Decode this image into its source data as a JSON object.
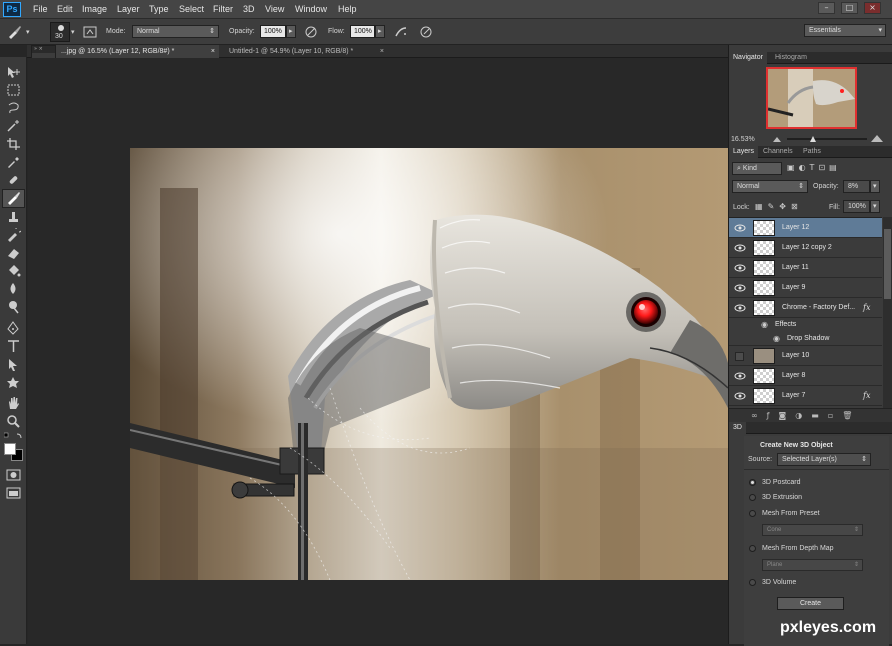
{
  "app": {
    "logo": "Ps"
  },
  "menu": [
    "File",
    "Edit",
    "Image",
    "Layer",
    "Type",
    "Select",
    "Filter",
    "3D",
    "View",
    "Window",
    "Help"
  ],
  "window_controls": [
    "–",
    "□",
    "×"
  ],
  "options_bar": {
    "brush_size": "30",
    "mode_label": "Mode:",
    "mode_value": "Normal",
    "opacity_label": "Opacity:",
    "opacity_value": "100%",
    "flow_label": "Flow:",
    "flow_value": "100%",
    "workspace": "Essentials"
  },
  "document_tabs": [
    {
      "label": "...jpg @ 16.5% (Layer 12, RGB/8#) *",
      "close": "×",
      "active": true
    },
    {
      "label": "Untitled-1 @ 54.9% (Layer 10, RGB/8) *",
      "close": "×",
      "active": false
    }
  ],
  "navigator": {
    "tabs": [
      "Navigator",
      "Histogram"
    ],
    "zoom": "16.53%"
  },
  "layers_panel": {
    "tabs": [
      "Layers",
      "Channels",
      "Paths"
    ],
    "kind_label": "Kind",
    "blend_mode": "Normal",
    "opacity_label": "Opacity:",
    "opacity_value": "8%",
    "lock_label": "Lock:",
    "fill_label": "Fill:",
    "fill_value": "100%",
    "layers": [
      {
        "name": "Layer 12",
        "visible": true,
        "selected": true,
        "fx": ""
      },
      {
        "name": "Layer 12 copy 2",
        "visible": true,
        "selected": false,
        "fx": ""
      },
      {
        "name": "Layer 11",
        "visible": true,
        "selected": false,
        "fx": ""
      },
      {
        "name": "Layer 9",
        "visible": true,
        "selected": false,
        "fx": ""
      },
      {
        "name": "Chrome - Factory Def...",
        "visible": true,
        "selected": false,
        "fx": "fx"
      },
      {
        "name": "Effects",
        "visible": false,
        "selected": false,
        "fx": ""
      },
      {
        "name": "Drop Shadow",
        "visible": false,
        "selected": false,
        "fx": ""
      },
      {
        "name": "Layer 10",
        "visible": false,
        "selected": false,
        "fx": ""
      },
      {
        "name": "Layer 8",
        "visible": true,
        "selected": false,
        "fx": ""
      },
      {
        "name": "Layer 7",
        "visible": true,
        "selected": false,
        "fx": "fx"
      }
    ]
  },
  "panel_3d": {
    "tab": "3D",
    "title": "Create New 3D Object",
    "source_label": "Source:",
    "source_value": "Selected Layer(s)",
    "options": [
      {
        "label": "3D Postcard",
        "checked": true
      },
      {
        "label": "3D Extrusion",
        "checked": false
      },
      {
        "label": "Mesh From Preset",
        "checked": false
      },
      {
        "label": "Mesh From Depth Map",
        "checked": false
      },
      {
        "label": "3D Volume",
        "checked": false
      }
    ],
    "preset_dropdown": "Cone",
    "depth_dropdown": "Plane",
    "create_button": "Create"
  },
  "watermark": "pxleyes.com",
  "colors": {
    "accent_selection": "#5f7b97",
    "logo_blue": "#31a8ff",
    "navigator_frame": "#e03030",
    "eye_red": "#ff1a1a"
  }
}
